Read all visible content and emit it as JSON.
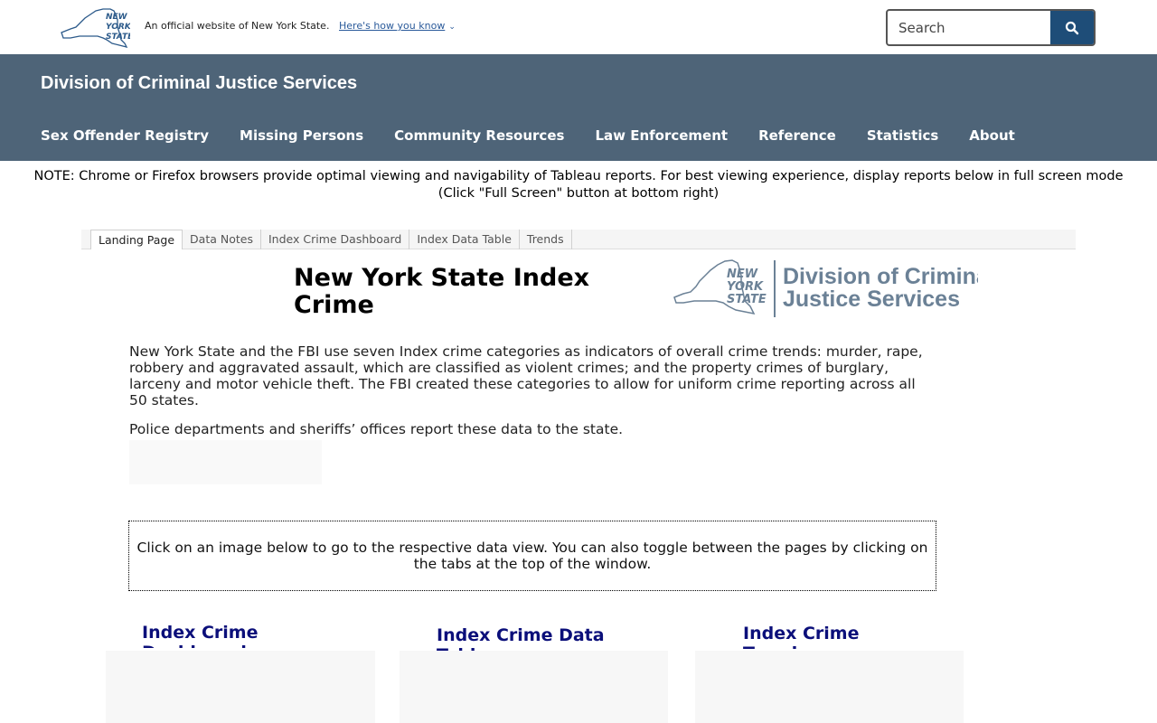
{
  "topbar": {
    "logo_text": [
      "NEW",
      "YORK",
      "STATE"
    ],
    "official_text": "An official website of New York State.",
    "how_you_know": "Here's how you know",
    "search_placeholder": "Search"
  },
  "agency": {
    "title": "Division of Criminal Justice Services",
    "nav": [
      {
        "label": "Sex Offender Registry"
      },
      {
        "label": "Missing Persons"
      },
      {
        "label": "Community Resources"
      },
      {
        "label": "Law Enforcement"
      },
      {
        "label": "Reference"
      },
      {
        "label": "Statistics"
      },
      {
        "label": "About"
      }
    ]
  },
  "note": "NOTE: Chrome or Firefox browsers provide optimal viewing and navigability of Tableau reports. For best viewing experience, display reports below in full screen mode (Click \"Full Screen\" button at bottom right)",
  "tableau": {
    "tabs": [
      {
        "label": "Landing Page",
        "active": true
      },
      {
        "label": "Data Notes"
      },
      {
        "label": "Index Crime Dashboard"
      },
      {
        "label": "Index Data Table"
      },
      {
        "label": "Trends"
      }
    ],
    "title": "New York State Index Crime",
    "dcjs_logo_text": [
      "NEW",
      "YORK",
      "STATE",
      "Division of Criminal",
      "Justice Services"
    ],
    "paragraph1": "New York State and the FBI use seven Index crime categories as indicators of overall crime trends: murder, rape, robbery and aggravated assault, which are classified as violent crimes; and the property crimes of burglary, larceny and motor vehicle theft. The FBI created these categories to allow for uniform crime reporting across all 50 states.",
    "paragraph2": "Police departments and sheriffs’ offices report these data to the state.",
    "instruction": "Click on an image below to go to the respective data view. You can also toggle between the pages by clicking on the tabs at the top of the window.",
    "cards": [
      {
        "title": "Index Crime Dashboard"
      },
      {
        "title": "Index Crime Data Table"
      },
      {
        "title": "Index Crime Trends"
      }
    ]
  },
  "colors": {
    "agency_bg": "#4e6478",
    "search_button": "#1e4d78",
    "card_title": "#0b0f7a"
  }
}
